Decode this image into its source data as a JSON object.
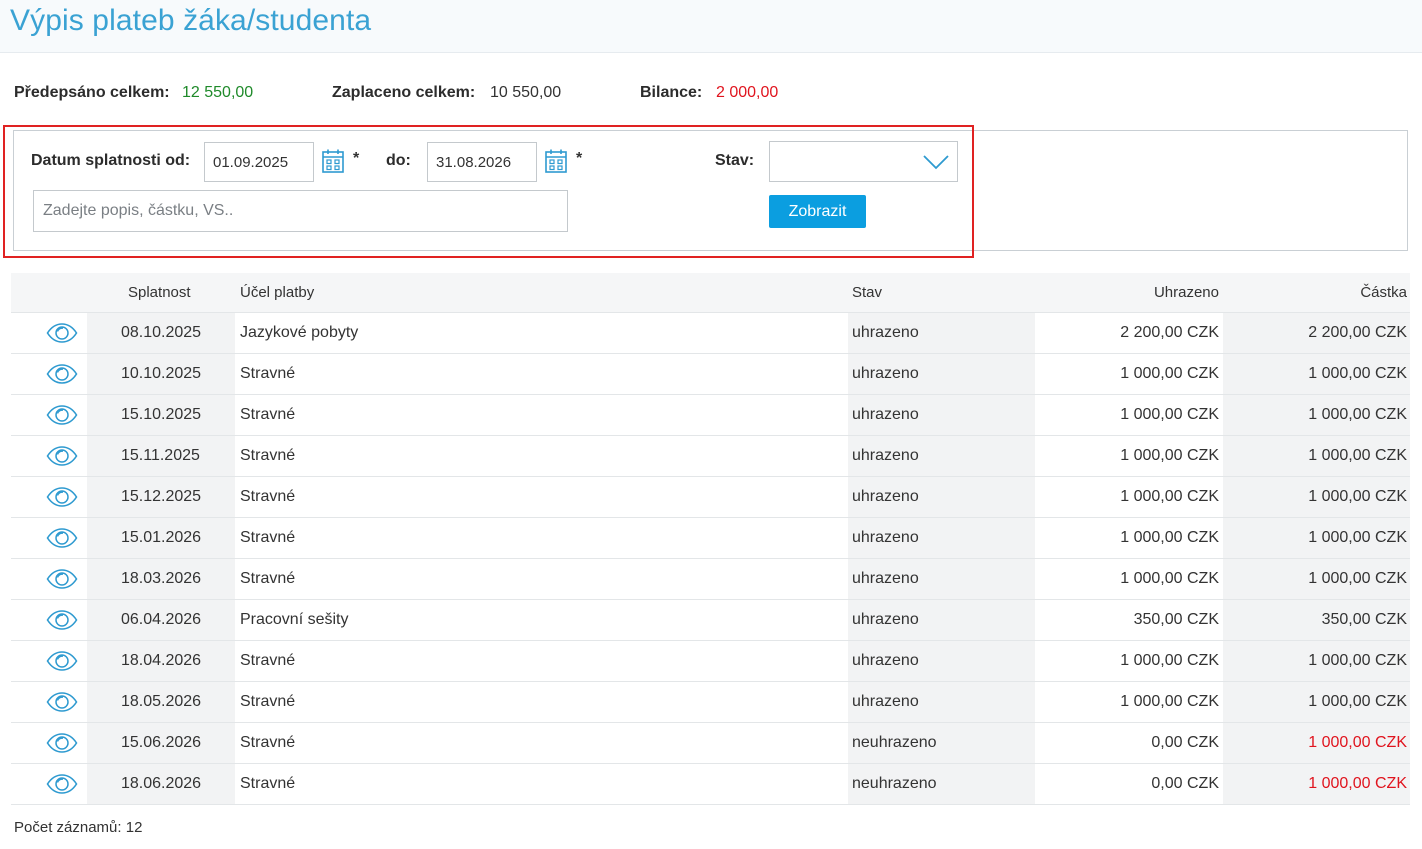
{
  "header": {
    "title": "Výpis plateb žáka/studenta"
  },
  "summary": {
    "predepsano_label": "Předepsáno celkem:",
    "predepsano_value": "12 550,00",
    "zaplaceno_label": "Zaplaceno celkem:",
    "zaplaceno_value": "10 550,00",
    "bilance_label": "Bilance:",
    "bilance_value": "2 000,00",
    "colors": {
      "predepsano": "#1f8a2a",
      "zaplaceno": "#333333",
      "bilance": "#e0141e"
    }
  },
  "filter": {
    "datum_od_label": "Datum splatnosti od:",
    "datum_od_value": "01.09.2025",
    "do_label": "do:",
    "datum_do_value": "31.08.2026",
    "required_mark": "*",
    "stav_label": "Stav:",
    "stav_value": "",
    "search_placeholder": "Zadejte popis, částku, VS..",
    "search_value": "",
    "submit_label": "Zobrazit",
    "accent": "#0b9ee0"
  },
  "table": {
    "columns": [
      "",
      "Splatnost",
      "Účel platby",
      "Stav",
      "Uhrazeno",
      "Částka"
    ],
    "rows": [
      {
        "splatnost": "08.10.2025",
        "ucel": "Jazykové pobyty",
        "stav": "uhrazeno",
        "uhrazeno": "2 200,00 CZK",
        "castka": "2 200,00 CZK",
        "unpaid": false
      },
      {
        "splatnost": "10.10.2025",
        "ucel": "Stravné",
        "stav": "uhrazeno",
        "uhrazeno": "1 000,00 CZK",
        "castka": "1 000,00 CZK",
        "unpaid": false
      },
      {
        "splatnost": "15.10.2025",
        "ucel": "Stravné",
        "stav": "uhrazeno",
        "uhrazeno": "1 000,00 CZK",
        "castka": "1 000,00 CZK",
        "unpaid": false
      },
      {
        "splatnost": "15.11.2025",
        "ucel": "Stravné",
        "stav": "uhrazeno",
        "uhrazeno": "1 000,00 CZK",
        "castka": "1 000,00 CZK",
        "unpaid": false
      },
      {
        "splatnost": "15.12.2025",
        "ucel": "Stravné",
        "stav": "uhrazeno",
        "uhrazeno": "1 000,00 CZK",
        "castka": "1 000,00 CZK",
        "unpaid": false
      },
      {
        "splatnost": "15.01.2026",
        "ucel": "Stravné",
        "stav": "uhrazeno",
        "uhrazeno": "1 000,00 CZK",
        "castka": "1 000,00 CZK",
        "unpaid": false
      },
      {
        "splatnost": "18.03.2026",
        "ucel": "Stravné",
        "stav": "uhrazeno",
        "uhrazeno": "1 000,00 CZK",
        "castka": "1 000,00 CZK",
        "unpaid": false
      },
      {
        "splatnost": "06.04.2026",
        "ucel": "Pracovní sešity",
        "stav": "uhrazeno",
        "uhrazeno": "350,00 CZK",
        "castka": "350,00 CZK",
        "unpaid": false
      },
      {
        "splatnost": "18.04.2026",
        "ucel": "Stravné",
        "stav": "uhrazeno",
        "uhrazeno": "1 000,00 CZK",
        "castka": "1 000,00 CZK",
        "unpaid": false
      },
      {
        "splatnost": "18.05.2026",
        "ucel": "Stravné",
        "stav": "uhrazeno",
        "uhrazeno": "1 000,00 CZK",
        "castka": "1 000,00 CZK",
        "unpaid": false
      },
      {
        "splatnost": "15.06.2026",
        "ucel": "Stravné",
        "stav": "neuhrazeno",
        "uhrazeno": "0,00 CZK",
        "castka": "1 000,00 CZK",
        "unpaid": true
      },
      {
        "splatnost": "18.06.2026",
        "ucel": "Stravné",
        "stav": "neuhrazeno",
        "uhrazeno": "0,00 CZK",
        "castka": "1 000,00 CZK",
        "unpaid": true
      }
    ]
  },
  "footer": {
    "count_text": "Počet záznamů: 12"
  },
  "icons": {
    "row_action": "eye-icon",
    "date_picker": "calendar-icon",
    "select": "chevron-down-icon"
  }
}
